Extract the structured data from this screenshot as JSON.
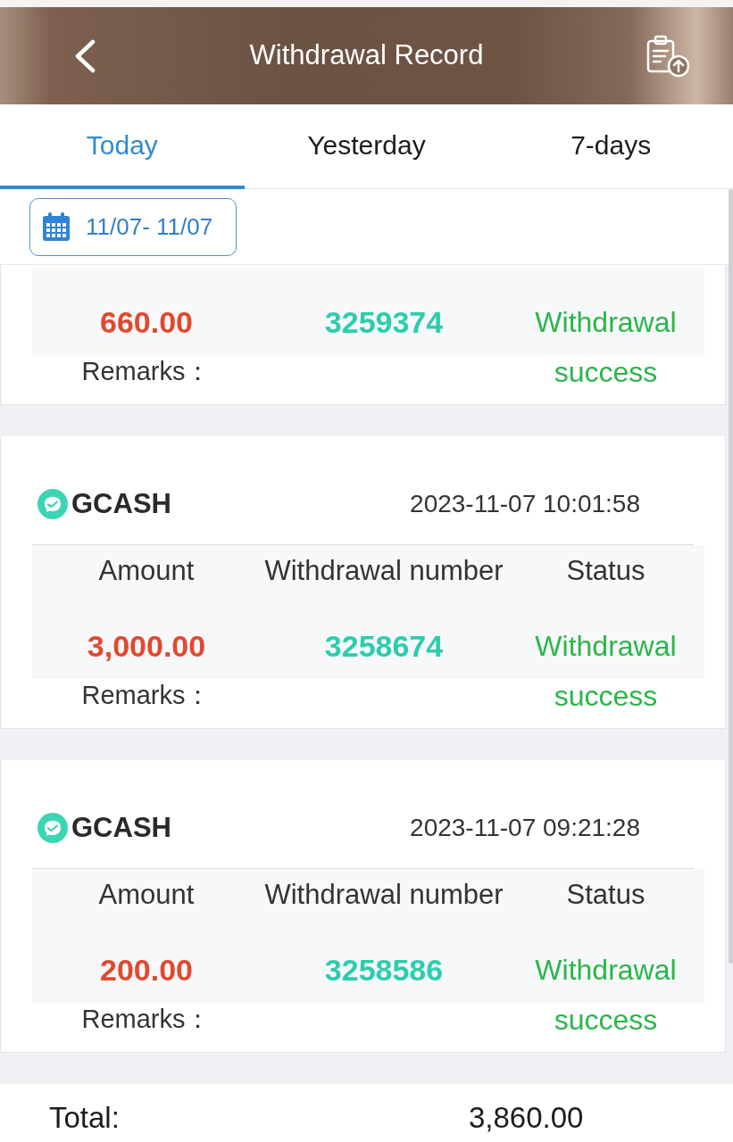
{
  "header": {
    "title": "Withdrawal Record"
  },
  "tabs": [
    {
      "label": "Today",
      "selected": true
    },
    {
      "label": "Yesterday",
      "selected": false
    },
    {
      "label": "7-days",
      "selected": false
    }
  ],
  "date_range": {
    "label": "11/07- 11/07"
  },
  "records": [
    {
      "amount": "660.00",
      "withdrawal_number": "3259374",
      "status": "Withdrawal success",
      "remarks_label": "Remarks："
    },
    {
      "method": "GCASH",
      "time": "2023-11-07 10:01:58",
      "labels": [
        "Amount",
        "Withdrawal number",
        "Status"
      ],
      "amount": "3,000.00",
      "withdrawal_number": "3258674",
      "status": "Withdrawal success",
      "remarks_label": "Remarks："
    },
    {
      "method": "GCASH",
      "time": "2023-11-07 09:21:28",
      "labels": [
        "Amount",
        "Withdrawal number",
        "Status"
      ],
      "amount": "200.00",
      "withdrawal_number": "3258586",
      "status": "Withdrawal success",
      "remarks_label": "Remarks："
    }
  ],
  "total": {
    "label": "Total:",
    "value": "3,860.00"
  }
}
